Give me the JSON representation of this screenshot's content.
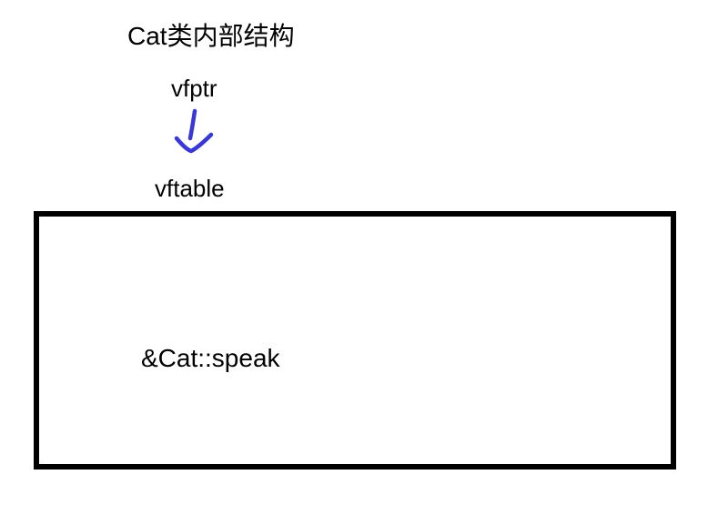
{
  "title": "Cat类内部结构",
  "vfptr_label": "vfptr",
  "vftable_label": "vftable",
  "box_content": "&Cat::speak",
  "arrow": {
    "stroke_color": "#3838d8",
    "stroke_width": 4
  }
}
